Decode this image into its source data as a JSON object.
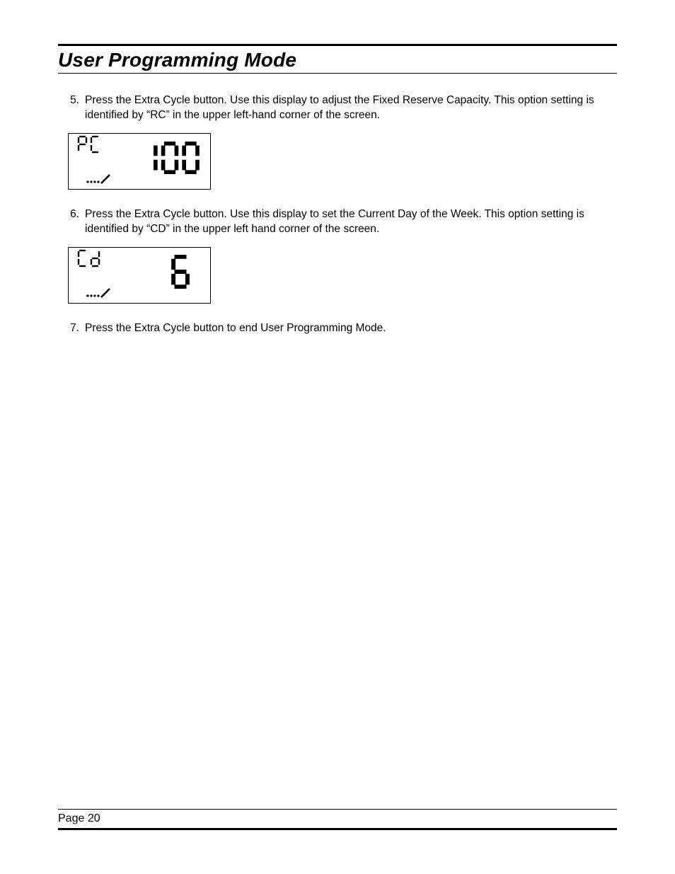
{
  "header": {
    "title": "User Programming Mode"
  },
  "steps": [
    {
      "number": "5.",
      "text": "Press the Extra Cycle button. Use this display to adjust the Fixed Reserve Capacity. This option setting is identified by “RC” in the upper left-hand corner of the screen.",
      "lcd": {
        "label": "RC",
        "value": "100"
      }
    },
    {
      "number": "6.",
      "text": "Press the Extra Cycle button. Use this display to set the Current Day of the Week. This option setting is identified by “CD” in the upper left hand corner of the screen.",
      "lcd": {
        "label": "CD",
        "value": "6"
      }
    },
    {
      "number": "7.",
      "text": "Press the Extra Cycle button to end User Programming Mode."
    }
  ],
  "footer": {
    "page_label": "Page 20"
  }
}
